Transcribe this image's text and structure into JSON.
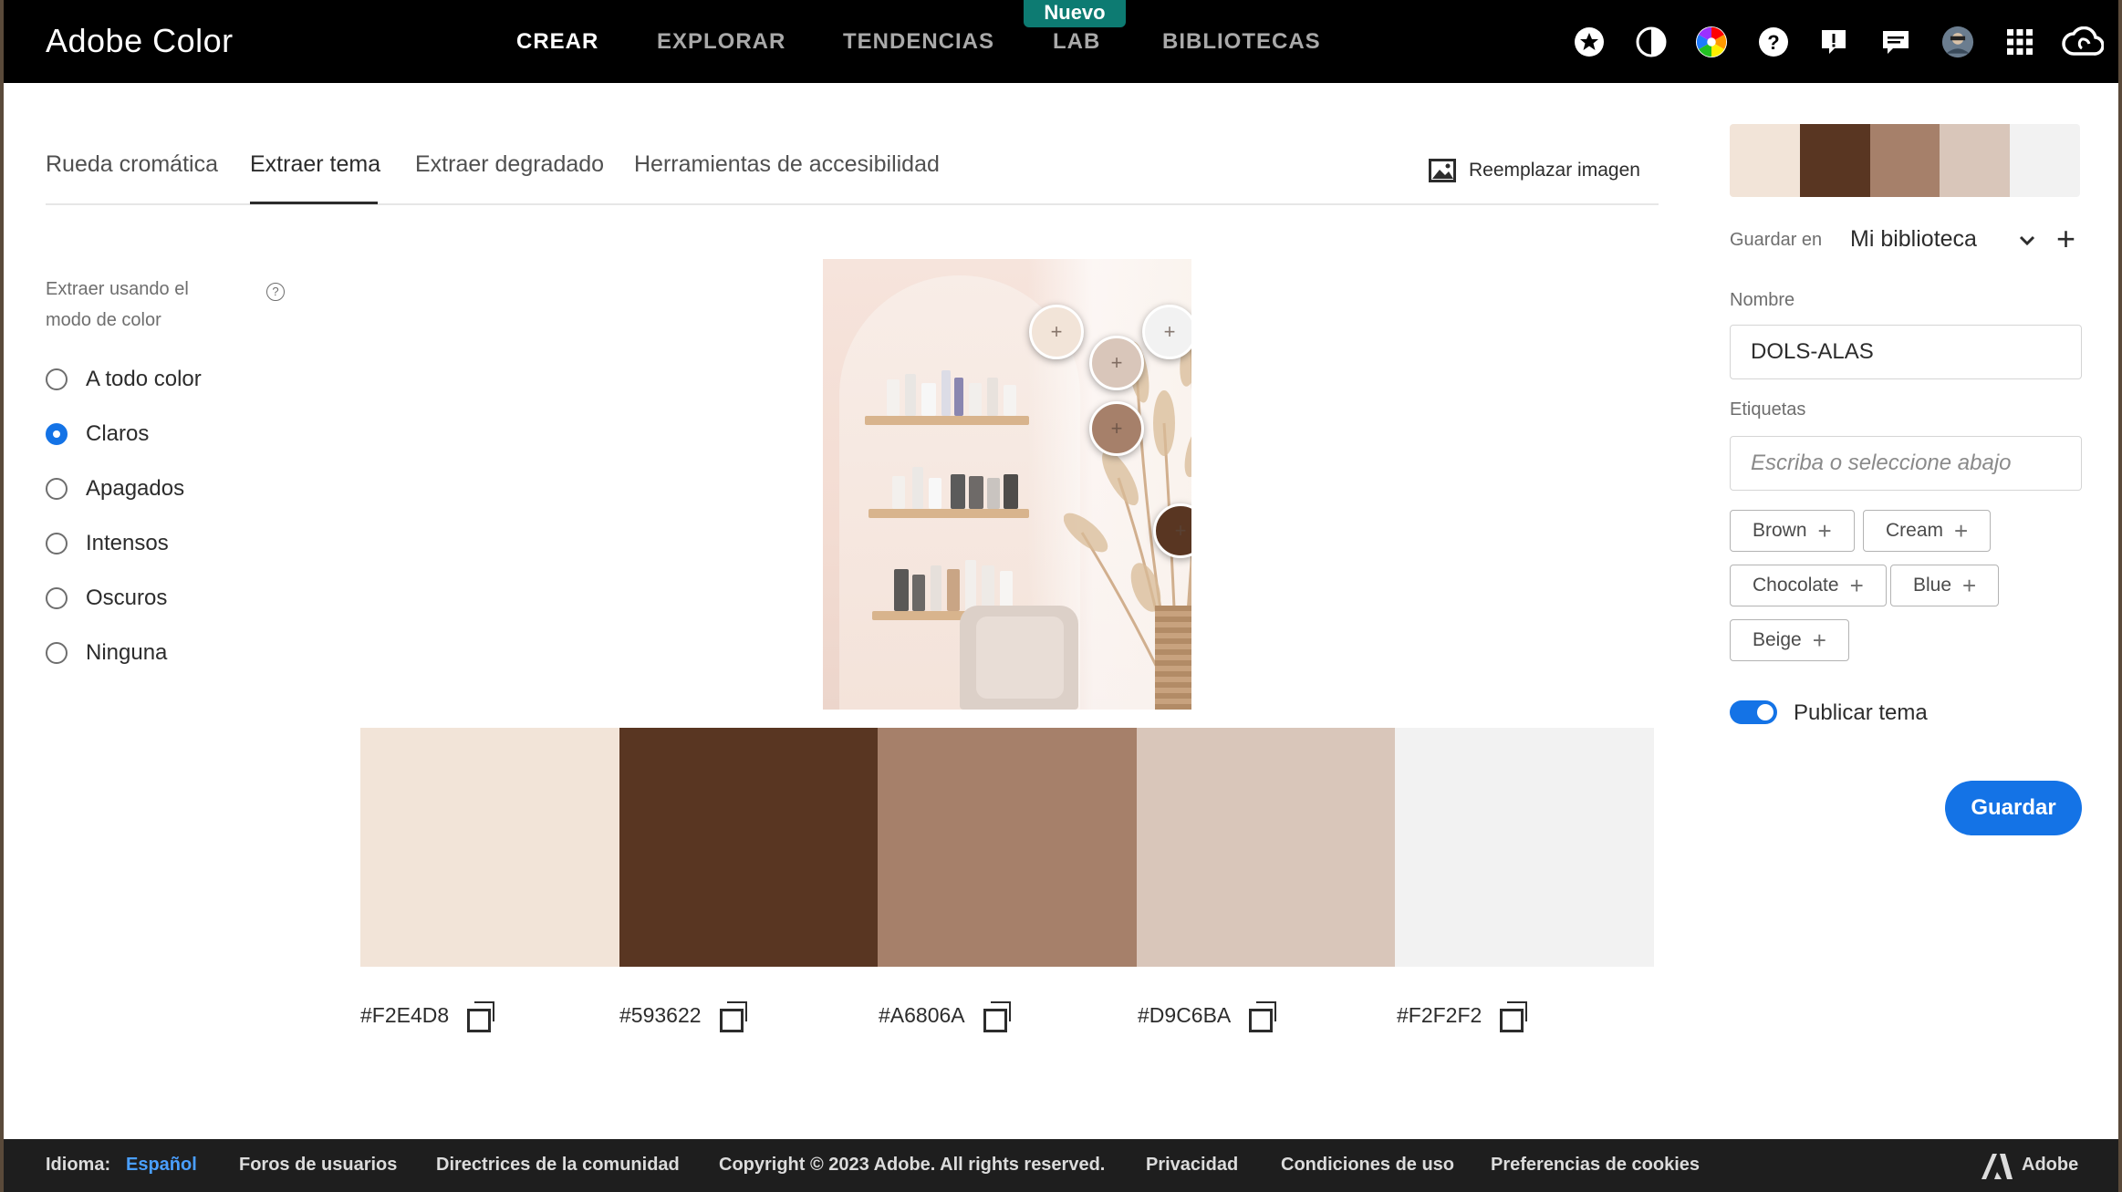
{
  "app": {
    "title": "Adobe Color"
  },
  "nav": {
    "items": [
      "CREAR",
      "EXPLORAR",
      "TENDENCIAS",
      "LAB",
      "BIBLIOTECAS"
    ],
    "new_badge": "Nuevo"
  },
  "tabs": [
    "Rueda cromática",
    "Extraer tema",
    "Extraer degradado",
    "Herramientas de accesibilidad"
  ],
  "replace_image": "Reemplazar imagen",
  "extract": {
    "mode_label": "Extraer usando el modo de color",
    "options": [
      "A todo color",
      "Claros",
      "Apagados",
      "Intensos",
      "Oscuros",
      "Ninguna"
    ],
    "selected": "Claros"
  },
  "swatches": [
    {
      "hex": "#F2E4D8",
      "color": "#F2E4D8"
    },
    {
      "hex": "#593622",
      "color": "#593622"
    },
    {
      "hex": "#A6806A",
      "color": "#A6806A"
    },
    {
      "hex": "#D9C6BA",
      "color": "#D9C6BA"
    },
    {
      "hex": "#F2F2F2",
      "color": "#F2F2F2"
    }
  ],
  "panel": {
    "save_in_label": "Guardar en",
    "library": "Mi biblioteca",
    "name_label": "Nombre",
    "name_value": "DOLS-ALAS",
    "tags_label": "Etiquetas",
    "tags_placeholder": "Escriba o seleccione abajo",
    "tags": [
      "Brown",
      "Cream",
      "Chocolate",
      "Blue",
      "Beige"
    ],
    "publish_label": "Publicar tema",
    "publish_on": true,
    "save_button": "Guardar"
  },
  "footer": {
    "language_label": "Idioma:",
    "language_value": "Español",
    "links": [
      "Foros de usuarios",
      "Directrices de la comunidad",
      "Copyright © 2023 Adobe. All rights reserved.",
      "Privacidad",
      "Condiciones de uso",
      "Preferencias de cookies"
    ],
    "brand": "Adobe"
  },
  "colors": {
    "accent": "#1473E6",
    "badge": "#0D7B72",
    "topbar": "#000000",
    "footer": "#1E1E1E"
  }
}
